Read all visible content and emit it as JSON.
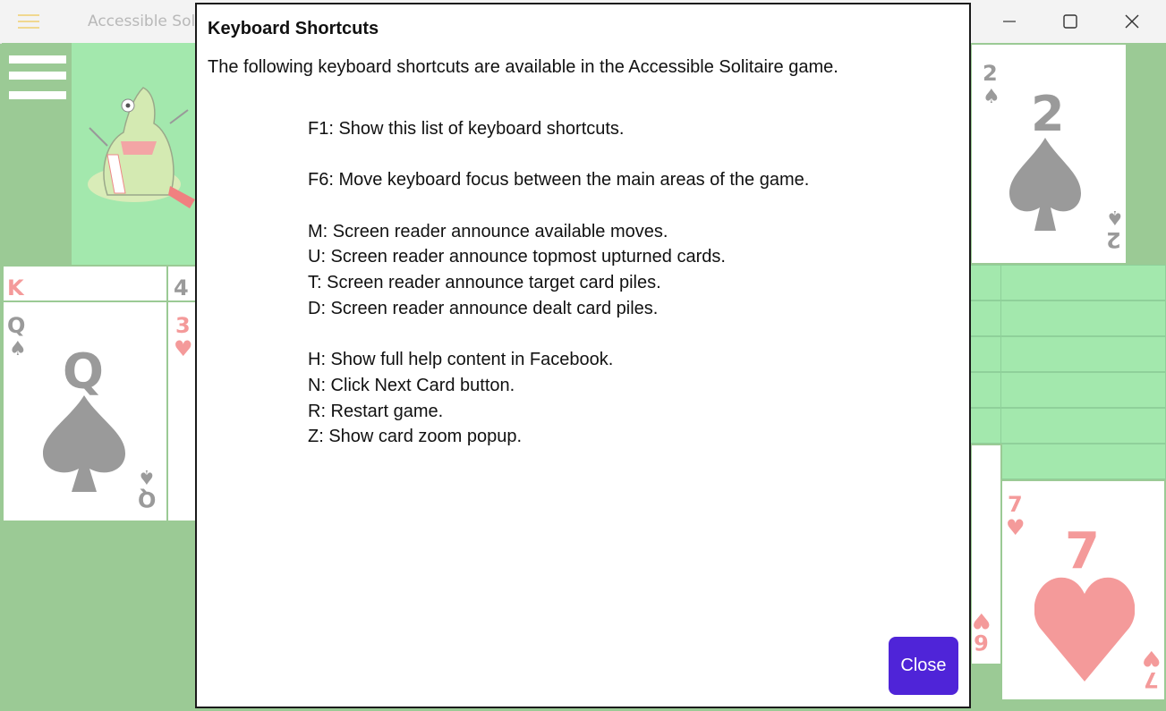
{
  "window": {
    "title": "Accessible Soli",
    "minimize_glyph": "—",
    "maximize_glyph": "☐",
    "close_glyph": "✕"
  },
  "board": {
    "menu_icon": "hamburger-icon",
    "dragon_image": "dragon-mascot",
    "top_right_card": {
      "rank": "2",
      "suit": "♠"
    },
    "queen_card": {
      "rank": "Q",
      "suit": "♠"
    },
    "king_label": "K",
    "four_label": "4",
    "three_card": {
      "rank": "3",
      "suit": "♥"
    },
    "seven_card": {
      "rank": "7",
      "suit": "♥"
    },
    "six_label": "6",
    "colors": {
      "board": "#9bca95",
      "target": "#a3e8ad",
      "red_suit": "#f49a9a",
      "black_suit": "#9a9a9a"
    }
  },
  "dialog": {
    "title": "Keyboard Shortcuts",
    "intro": "The following keyboard shortcuts are available in the Accessible Solitaire game.",
    "groups": [
      [
        "F1: Show this list of keyboard shortcuts."
      ],
      [
        "F6: Move keyboard focus between the main areas of the game."
      ],
      [
        "M: Screen reader announce available moves.",
        "U: Screen reader announce topmost upturned cards.",
        "T: Screen reader announce target card piles.",
        "D: Screen reader announce dealt card piles."
      ],
      [
        "H: Show full help content in Facebook.",
        "N: Click Next Card button.",
        "R: Restart game.",
        "Z: Show card zoom popup."
      ]
    ],
    "close_label": "Close",
    "close_color": "#4f24d8"
  }
}
